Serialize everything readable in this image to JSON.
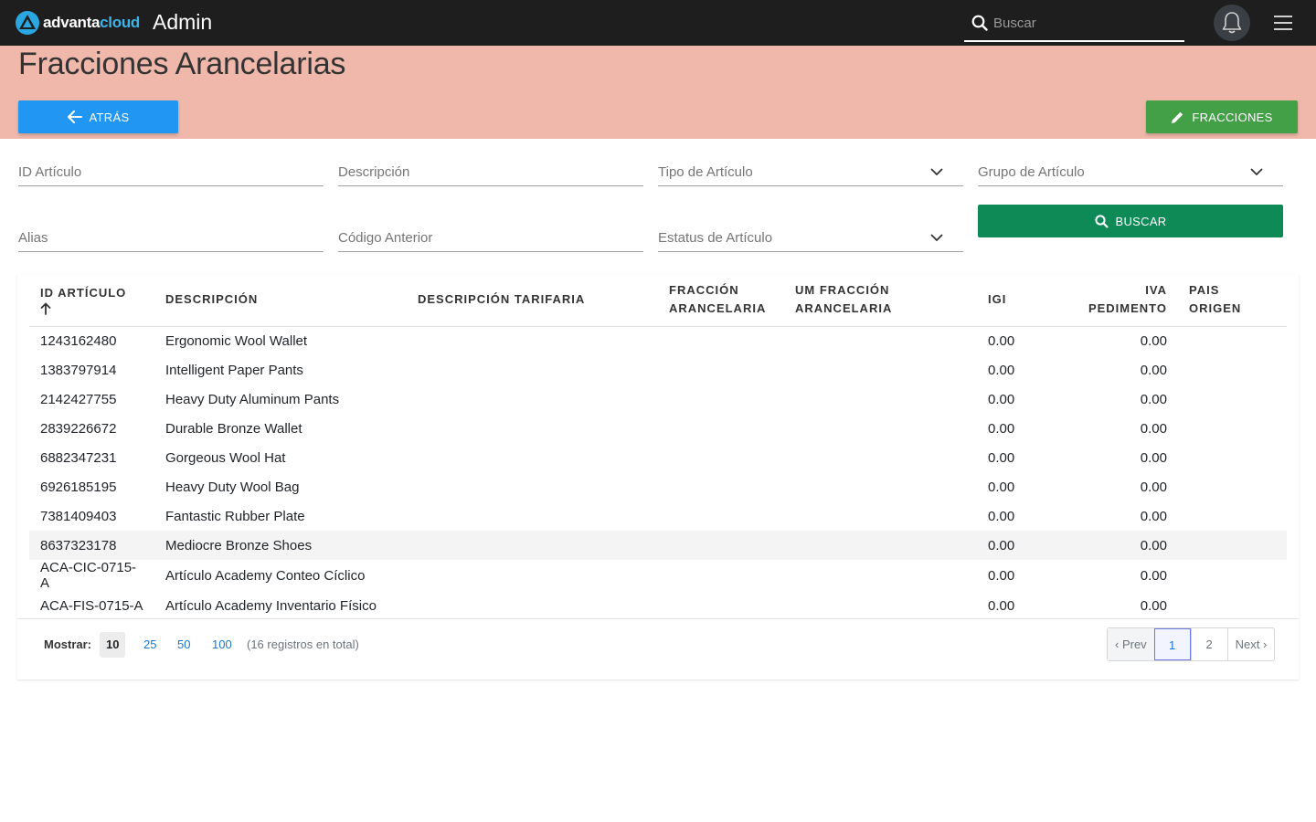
{
  "topbar": {
    "brand_part1": "advanta",
    "brand_part2": "cloud",
    "app_title": "Admin",
    "search_placeholder": "Buscar",
    "icons": [
      "search-icon",
      "bell-icon",
      "menu-icon"
    ]
  },
  "header": {
    "title": "Fracciones Arancelarias",
    "back_label": "ATRÁS",
    "fracciones_label": "FRACCIONES"
  },
  "filters": {
    "id_articulo": "ID Artículo",
    "descripcion": "Descripción",
    "tipo_articulo": "Tipo de Artículo",
    "grupo_articulo": "Grupo de Artículo",
    "alias": "Alias",
    "codigo_anterior": "Código Anterior",
    "estatus_articulo": "Estatus de Artículo",
    "buscar_label": "BUSCAR"
  },
  "table": {
    "columns": {
      "id": "ID ARTÍCULO",
      "descripcion": "DESCRIPCIÓN",
      "desc_tarifaria": "DESCRIPCIÓN TARIFARIA",
      "fraccion_1": "FRACCIÓN",
      "fraccion_2": "ARANCELARIA",
      "um_1": "UM FRACCIÓN",
      "um_2": "ARANCELARIA",
      "igi": "IGI",
      "iva_1": "IVA",
      "iva_2": "PEDIMENTO",
      "pais": "PAIS ORIGEN"
    },
    "rows": [
      {
        "id": "1243162480",
        "descripcion": "Ergonomic Wool Wallet",
        "igi": "0.00",
        "iva": "0.00"
      },
      {
        "id": "1383797914",
        "descripcion": "Intelligent Paper Pants",
        "igi": "0.00",
        "iva": "0.00"
      },
      {
        "id": "2142427755",
        "descripcion": "Heavy Duty Aluminum Pants",
        "igi": "0.00",
        "iva": "0.00"
      },
      {
        "id": "2839226672",
        "descripcion": "Durable Bronze Wallet",
        "igi": "0.00",
        "iva": "0.00"
      },
      {
        "id": "6882347231",
        "descripcion": "Gorgeous Wool Hat",
        "igi": "0.00",
        "iva": "0.00"
      },
      {
        "id": "6926185195",
        "descripcion": "Heavy Duty Wool Bag",
        "igi": "0.00",
        "iva": "0.00"
      },
      {
        "id": "7381409403",
        "descripcion": "Fantastic Rubber Plate",
        "igi": "0.00",
        "iva": "0.00"
      },
      {
        "id": "8637323178",
        "descripcion": "Mediocre Bronze Shoes",
        "igi": "0.00",
        "iva": "0.00"
      },
      {
        "id": "ACA-CIC-0715-A",
        "descripcion": "Artículo Academy Conteo Cíclico",
        "igi": "0.00",
        "iva": "0.00"
      },
      {
        "id": "ACA-FIS-0715-A",
        "descripcion": "Artículo Academy Inventario Físico",
        "igi": "0.00",
        "iva": "0.00"
      }
    ]
  },
  "footer": {
    "mostrar_label": "Mostrar:",
    "page_sizes": [
      "10",
      "25",
      "50",
      "100"
    ],
    "total_text": "(16 registros en total)",
    "prev_label": "‹ Prev",
    "pages": [
      "1",
      "2"
    ],
    "next_label": "Next ›"
  }
}
